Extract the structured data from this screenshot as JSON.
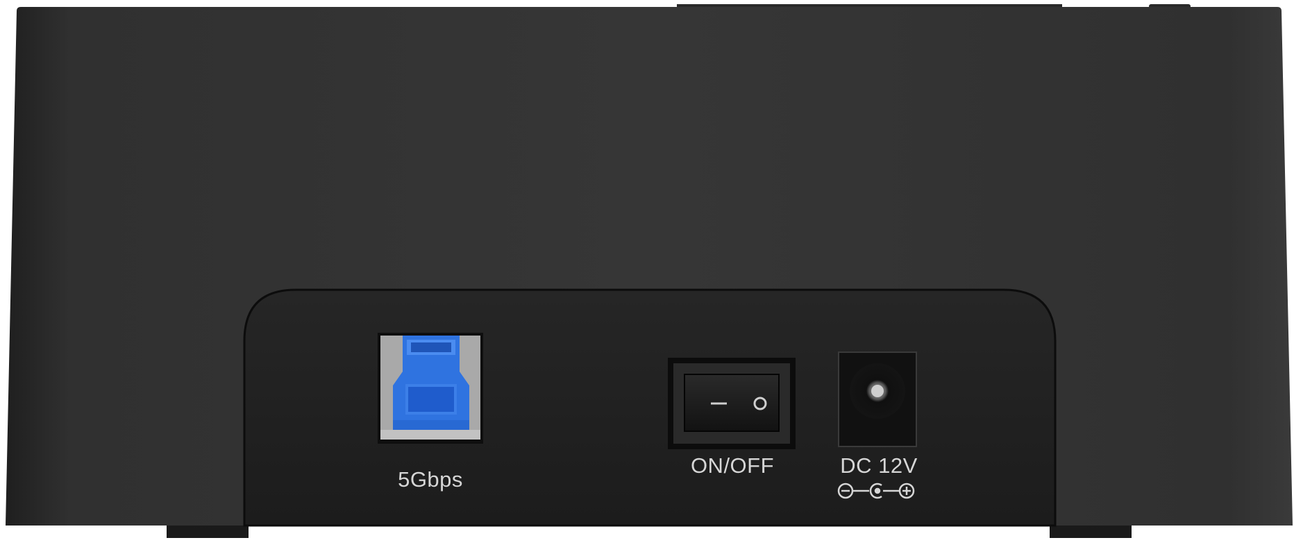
{
  "device": {
    "usb_port_label": "5Gbps",
    "power_switch_label": "ON/OFF",
    "dc_input_label": "DC 12V"
  },
  "colors": {
    "body": "#333333",
    "port_panel": "#202020",
    "usb_blue": "#2f73e0",
    "label_text": "#d6d6d6"
  },
  "icons": [
    "usb-b-port",
    "rocker-switch",
    "dc-barrel-jack",
    "polarity-symbol"
  ]
}
